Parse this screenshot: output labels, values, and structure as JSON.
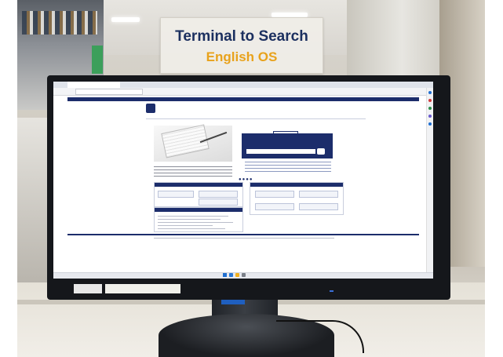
{
  "sign": {
    "line1": "Terminal to Search",
    "line2": "English OS"
  },
  "colors": {
    "sign_line1": "#1b2f5f",
    "sign_line2": "#e8a21c",
    "site_navy": "#1c2d6b",
    "monitor": "#15171b"
  },
  "screen": {
    "page": "library-search-portal",
    "elements": [
      "search-panel",
      "image-carousel",
      "info-panels",
      "taskbar"
    ]
  },
  "icons": [
    "windows-start-icon",
    "edge-browser-icon",
    "search-icon"
  ]
}
